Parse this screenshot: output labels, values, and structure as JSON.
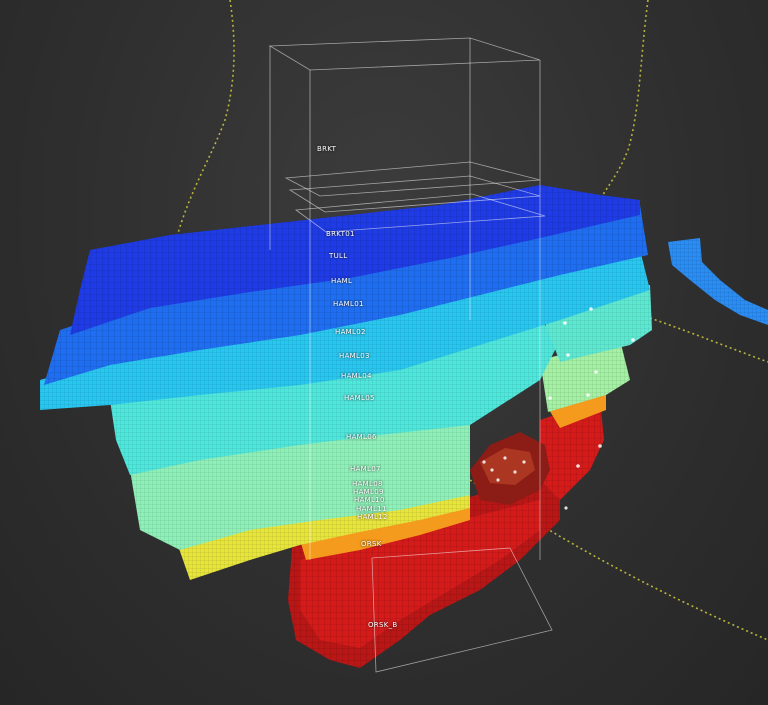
{
  "colors": {
    "background": "#2d2d2d",
    "deep_blue": "#1e3be6",
    "blue": "#1f6df0",
    "cyan": "#29c6ef",
    "aqua": "#4fe6dc",
    "mint": "#8ef0b8",
    "yellow": "#e7e53c",
    "orange": "#f49a1c",
    "red": "#d51a1a",
    "dark_red": "#8c1c16",
    "well_path": "#b8b43a"
  },
  "horizon_labels": [
    {
      "text": "BRKT"
    },
    {
      "text": "BRKT01"
    },
    {
      "text": "TULL"
    },
    {
      "text": "HAML"
    },
    {
      "text": "HAML01"
    },
    {
      "text": "HAML02"
    },
    {
      "text": "HAML03"
    },
    {
      "text": "HAML04"
    },
    {
      "text": "HAML05"
    },
    {
      "text": "HAML06"
    },
    {
      "text": "HAML07"
    },
    {
      "text": "HAML08"
    },
    {
      "text": "HAML09"
    },
    {
      "text": "HAML10"
    },
    {
      "text": "HAML11"
    },
    {
      "text": "HAML12"
    },
    {
      "text": "ORSK"
    },
    {
      "text": "ORSK_B"
    }
  ]
}
